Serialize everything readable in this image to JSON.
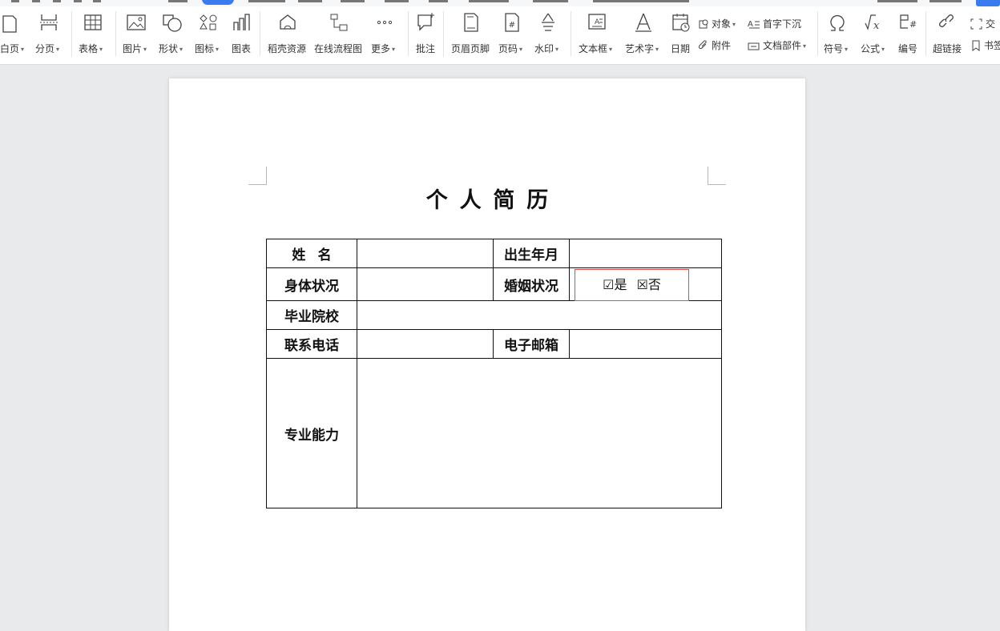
{
  "ribbon": {
    "tools": [
      {
        "id": "blank-page",
        "label": "白页",
        "dropdown": true,
        "icon": "blank-page-icon"
      },
      {
        "id": "page-break",
        "label": "分页",
        "dropdown": true,
        "icon": "page-break-icon"
      },
      {
        "id": "table",
        "label": "表格",
        "dropdown": true,
        "icon": "table-icon"
      },
      {
        "id": "picture",
        "label": "图片",
        "dropdown": true,
        "icon": "picture-icon"
      },
      {
        "id": "shape",
        "label": "形状",
        "dropdown": true,
        "icon": "shape-icon"
      },
      {
        "id": "icon",
        "label": "图标",
        "dropdown": true,
        "icon": "icons-icon"
      },
      {
        "id": "chart",
        "label": "图表",
        "dropdown": false,
        "icon": "chart-icon"
      },
      {
        "id": "shell-resources",
        "label": "稻壳资源",
        "dropdown": false,
        "icon": "shell-resources-icon"
      },
      {
        "id": "flowchart",
        "label": "在线流程图",
        "dropdown": false,
        "icon": "flowchart-icon"
      },
      {
        "id": "more",
        "label": "更多",
        "dropdown": true,
        "icon": "more-icon"
      },
      {
        "id": "comment",
        "label": "批注",
        "dropdown": false,
        "icon": "comment-icon"
      },
      {
        "id": "header-footer",
        "label": "页眉页脚",
        "dropdown": false,
        "icon": "header-footer-icon"
      },
      {
        "id": "page-number",
        "label": "页码",
        "dropdown": true,
        "icon": "page-number-icon"
      },
      {
        "id": "watermark",
        "label": "水印",
        "dropdown": true,
        "icon": "watermark-icon"
      },
      {
        "id": "textbox",
        "label": "文本框",
        "dropdown": true,
        "icon": "textbox-icon"
      },
      {
        "id": "wordart",
        "label": "艺术字",
        "dropdown": true,
        "icon": "wordart-icon"
      },
      {
        "id": "date",
        "label": "日期",
        "dropdown": false,
        "icon": "date-icon"
      },
      {
        "id": "symbol",
        "label": "符号",
        "dropdown": true,
        "icon": "symbol-icon"
      },
      {
        "id": "formula",
        "label": "公式",
        "dropdown": true,
        "icon": "formula-icon"
      },
      {
        "id": "numbering",
        "label": "编号",
        "dropdown": false,
        "icon": "numbering-icon"
      },
      {
        "id": "hyperlink",
        "label": "超链接",
        "dropdown": false,
        "icon": "hyperlink-icon"
      }
    ],
    "small_tools": {
      "object": "对象",
      "attachment": "附件",
      "drop_cap": "首字下沉",
      "doc_parts": "文档部件",
      "cross_ref": "交",
      "bookmark": "书签"
    },
    "caret": "▾"
  },
  "document": {
    "title": "个人简历",
    "rows": {
      "name_label": "姓名",
      "birth_label": "出生年月",
      "health_label": "身体状况",
      "marital_label": "婚姻状况",
      "marital_yes": "☑是",
      "marital_no": "☒否",
      "school_label": "毕业院校",
      "phone_label": "联系电话",
      "email_label": "电子邮箱",
      "skills_label": "专业能力"
    }
  },
  "colors": {
    "accent": "#3a7bf0",
    "selection_border": "#e04b4b",
    "canvas": "#e9eaec"
  }
}
